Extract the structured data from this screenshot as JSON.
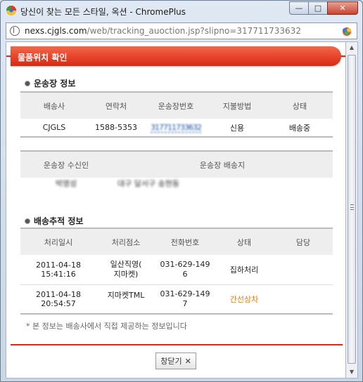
{
  "window": {
    "title": "당신이 찾는 모든 스타일, 옥션 - ChromePlus",
    "minimize": "—",
    "maximize": "□",
    "close": "✕"
  },
  "address": {
    "host": "nexs.cjgls.com",
    "path": "/web/tracking_auoction.jsp?slipno=317711733632"
  },
  "page": {
    "header_title": "물품위치 확인",
    "section1_title": "운송장 정보",
    "table1": {
      "headers": [
        "배송사",
        "연락처",
        "운송장번호",
        "지불방법",
        "상태"
      ],
      "row": [
        "CJGLS",
        "1588-5353",
        "317711733632",
        "신용",
        "배송중"
      ]
    },
    "table2": {
      "headers": [
        "운송장 수신인",
        "운송장 배송지"
      ],
      "row": [
        "박영성",
        "대구 달서구 송현동"
      ]
    },
    "section2_title": "배송추적 정보",
    "table3": {
      "headers": [
        "처리일시",
        "처리점소",
        "전화번호",
        "상태",
        "담당"
      ],
      "rows": [
        {
          "date": "2011-04-18 15:41:16",
          "office": "일산직영(\n지마켓)",
          "phone": "031-629-149\n6",
          "status": "집하처리",
          "staff": ""
        },
        {
          "date": "2011-04-18 20:54:57",
          "office": "지마켓TML",
          "phone": "031-629-149\n7",
          "status": "간선상차",
          "staff": ""
        }
      ]
    },
    "note": "* 본 정보는 배송사에서 직접 제공하는 정보입니다",
    "close_button": "창닫기"
  }
}
